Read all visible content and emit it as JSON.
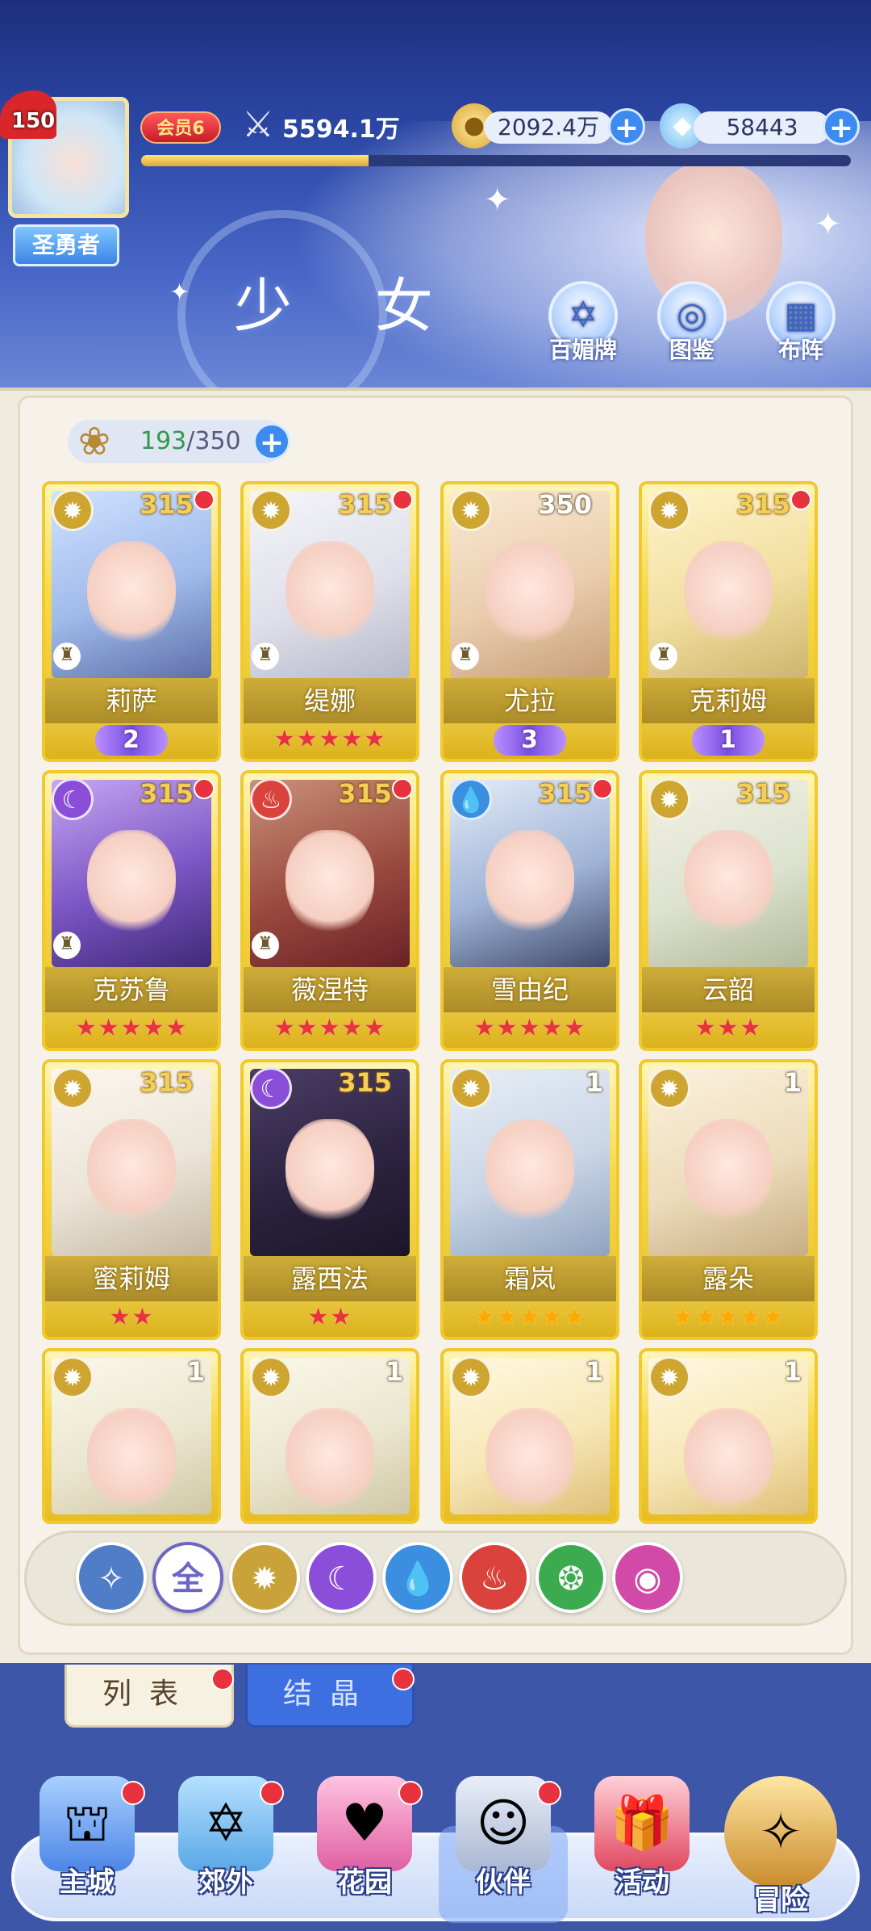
{
  "header": {
    "page_title": "少 女",
    "player": {
      "level": "150",
      "title": "圣勇者",
      "vip": "会员6"
    },
    "power": "5594.1万",
    "power_progress": 0.32,
    "gold": "2092.4万",
    "gems": "58443",
    "actions": [
      {
        "label": "百媚牌",
        "icon": "card-deck-icon"
      },
      {
        "label": "图鉴",
        "icon": "book-icon"
      },
      {
        "label": "布阵",
        "icon": "grid-formation-icon"
      }
    ]
  },
  "capacity": {
    "current": "193",
    "max": "/350"
  },
  "cards": [
    {
      "name": "莉萨",
      "level": "315",
      "element": "light",
      "rank": "2",
      "stars": "",
      "star_type": "",
      "rook": true,
      "dot": true
    },
    {
      "name": "缇娜",
      "level": "315",
      "element": "light",
      "rank": "",
      "stars": "★★★★★",
      "star_type": "red",
      "rook": true,
      "dot": true
    },
    {
      "name": "尤拉",
      "level": "350",
      "element": "light",
      "rank": "3",
      "stars": "",
      "star_type": "",
      "rook": true,
      "dot": false
    },
    {
      "name": "克莉姆",
      "level": "315",
      "element": "light",
      "rank": "1",
      "stars": "",
      "star_type": "",
      "rook": true,
      "dot": true
    },
    {
      "name": "克苏鲁",
      "level": "315",
      "element": "dark",
      "rank": "",
      "stars": "★★★★★",
      "star_type": "red",
      "rook": true,
      "dot": true
    },
    {
      "name": "薇涅特",
      "level": "315",
      "element": "fire",
      "rank": "",
      "stars": "★★★★★",
      "star_type": "red",
      "rook": true,
      "dot": true
    },
    {
      "name": "雪由纪",
      "level": "315",
      "element": "water",
      "rank": "",
      "stars": "★★★★★",
      "star_type": "red",
      "rook": false,
      "dot": true
    },
    {
      "name": "云韶",
      "level": "315",
      "element": "light",
      "rank": "",
      "stars": "★★★",
      "star_type": "red",
      "rook": false,
      "dot": false
    },
    {
      "name": "蜜莉姆",
      "level": "315",
      "element": "light",
      "rank": "",
      "stars": "★★",
      "star_type": "red",
      "rook": false,
      "dot": false
    },
    {
      "name": "露西法",
      "level": "315",
      "element": "dark",
      "rank": "",
      "stars": "★★",
      "star_type": "red",
      "rook": false,
      "dot": false
    },
    {
      "name": "霜岚",
      "level": "1",
      "element": "light",
      "rank": "",
      "stars": "★★★★★",
      "star_type": "gold",
      "rook": false,
      "dot": false
    },
    {
      "name": "露朵",
      "level": "1",
      "element": "light",
      "rank": "",
      "stars": "★★★★★",
      "star_type": "gold",
      "rook": false,
      "dot": false
    },
    {
      "name": "",
      "level": "1",
      "element": "light",
      "rank": "",
      "stars": "",
      "star_type": "",
      "rook": false,
      "dot": false
    },
    {
      "name": "",
      "level": "1",
      "element": "light",
      "rank": "",
      "stars": "",
      "star_type": "",
      "rook": false,
      "dot": false
    },
    {
      "name": "",
      "level": "1",
      "element": "light",
      "rank": "",
      "stars": "",
      "star_type": "",
      "rook": false,
      "dot": false
    },
    {
      "name": "",
      "level": "1",
      "element": "light",
      "rank": "",
      "stars": "",
      "star_type": "",
      "rook": false,
      "dot": false
    }
  ],
  "filters": [
    {
      "label": "",
      "name": "filter-wind-star",
      "color": "#4f7dc8"
    },
    {
      "label": "全",
      "name": "filter-all",
      "color": "#6e66c7"
    },
    {
      "label": "",
      "name": "filter-light",
      "color": "#c9a23a"
    },
    {
      "label": "",
      "name": "filter-dark",
      "color": "#8a4ed8"
    },
    {
      "label": "",
      "name": "filter-water",
      "color": "#3b8ee0"
    },
    {
      "label": "",
      "name": "filter-fire",
      "color": "#d9433b"
    },
    {
      "label": "",
      "name": "filter-wind",
      "color": "#3cab50"
    },
    {
      "label": "",
      "name": "filter-chaos",
      "color": "#d24aa8"
    }
  ],
  "tabs": {
    "list": "列表",
    "crystal": "结晶"
  },
  "nav": [
    {
      "label": "主城",
      "icon": "castle-icon",
      "dot": true
    },
    {
      "label": "郊外",
      "icon": "portal-icon",
      "dot": true
    },
    {
      "label": "花园",
      "icon": "heart-garden-icon",
      "dot": true
    },
    {
      "label": "伙伴",
      "icon": "partner-icon",
      "dot": true
    },
    {
      "label": "活动",
      "icon": "gift-icon",
      "dot": false
    },
    {
      "label": "冒险",
      "icon": "compass-icon",
      "dot": false
    }
  ],
  "colors": {
    "light": "#cfa532",
    "dark": "#8a4ed8",
    "fire": "#d9433b",
    "water": "#3b8ee0",
    "card_gold": "#f0c92d",
    "badge_red": "#e8333f"
  }
}
